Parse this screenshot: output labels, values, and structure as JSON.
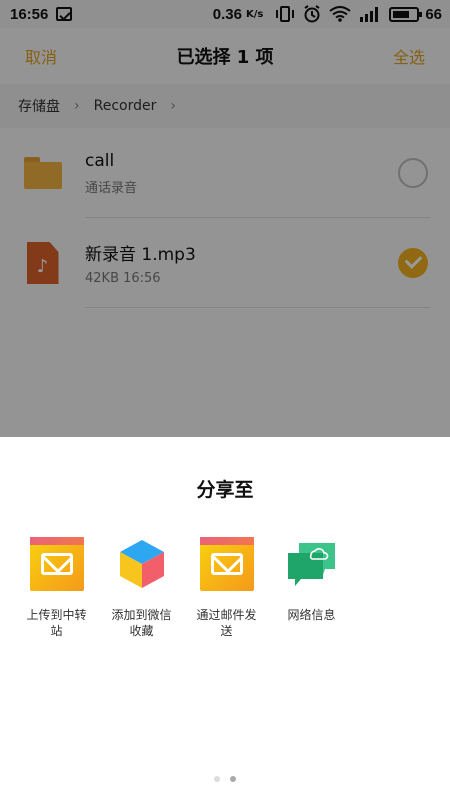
{
  "status_bar": {
    "time": "16:56",
    "net_speed": "0.36",
    "net_unit": "K/s",
    "battery": "66"
  },
  "header": {
    "cancel_label": "取消",
    "title": "已选择 1 项",
    "select_all_label": "全选"
  },
  "breadcrumb": {
    "items": [
      "存储盘",
      "Recorder"
    ]
  },
  "files": [
    {
      "name": "call",
      "meta": "通话录音",
      "selected": false,
      "icon": "folder-icon"
    },
    {
      "name": "新录音 1.mp3",
      "meta": "42KB  16:56",
      "selected": true,
      "icon": "audio-file-icon"
    }
  ],
  "share_sheet": {
    "title": "分享至",
    "targets": [
      {
        "label": "上传到中转站",
        "icon": "mail-icon"
      },
      {
        "label": "添加到微信收藏",
        "icon": "cube-icon"
      },
      {
        "label": "通过邮件发送",
        "icon": "mail-icon"
      },
      {
        "label": "网络信息",
        "icon": "cloud-chat-icon"
      }
    ],
    "pages": 2,
    "active_page": 2
  },
  "colors": {
    "accent": "#e0a020",
    "check": "#f2b020",
    "audio_file": "#d9622b",
    "folder": "#f0b142"
  }
}
